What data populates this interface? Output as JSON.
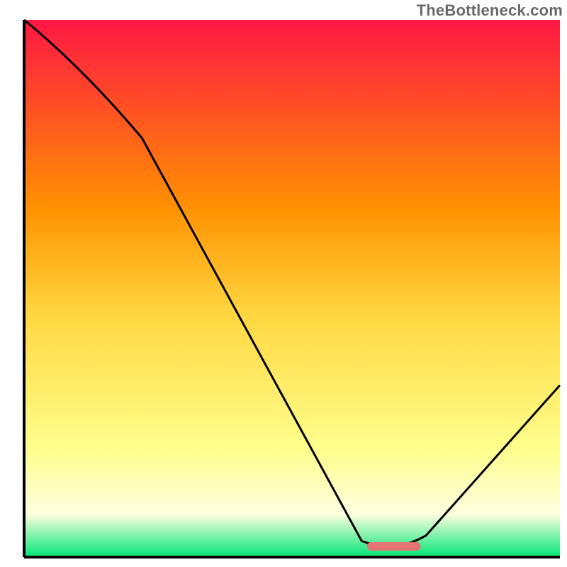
{
  "watermark": "TheBottleneck.com",
  "colors": {
    "top": "#ff1744",
    "upper_mid": "#ff9100",
    "mid": "#ffd740",
    "lower_mid": "#ffff8d",
    "pale": "#ffffe0",
    "green": "#00e676",
    "curve": "#000000",
    "axis": "#000000",
    "marker": "#e57373"
  },
  "chart_data": {
    "type": "line",
    "title": "",
    "xlabel": "",
    "ylabel": "",
    "xlim": [
      0,
      100
    ],
    "ylim": [
      0,
      100
    ],
    "x": [
      0,
      22,
      63,
      68,
      75,
      100
    ],
    "values": [
      100,
      78,
      3,
      2,
      4,
      32
    ],
    "marker": {
      "x_start": 64,
      "x_end": 74,
      "y": 2
    },
    "annotations": []
  }
}
